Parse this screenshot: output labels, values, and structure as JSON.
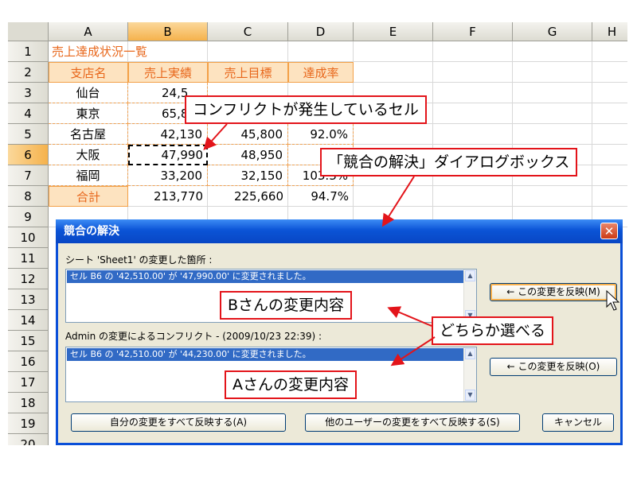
{
  "spreadsheet": {
    "columns": [
      "A",
      "B",
      "C",
      "D",
      "E",
      "F",
      "G",
      "H"
    ],
    "selected_column": "B",
    "rows": [
      "1",
      "2",
      "3",
      "4",
      "5",
      "6",
      "7",
      "8",
      "9",
      "10",
      "11",
      "12",
      "13",
      "14",
      "15",
      "16",
      "17",
      "18",
      "19",
      "20"
    ],
    "selected_row": "6",
    "title": "売上達成状況一覧",
    "headers": [
      "支店名",
      "売上実績",
      "売上目標",
      "達成率"
    ],
    "data": [
      {
        "branch": "仙台",
        "actual": "24,5",
        "target": "",
        "rate": ""
      },
      {
        "branch": "東京",
        "actual": "65,8",
        "target": "",
        "rate": ""
      },
      {
        "branch": "名古屋",
        "actual": "42,130",
        "target": "45,800",
        "rate": "92.0%"
      },
      {
        "branch": "大阪",
        "actual": "47,990",
        "target": "48,950",
        "rate": "9"
      },
      {
        "branch": "福岡",
        "actual": "33,200",
        "target": "32,150",
        "rate": "103.3%"
      }
    ],
    "total": {
      "label": "合計",
      "actual": "213,770",
      "target": "225,660",
      "rate": "94.7%"
    }
  },
  "callouts": {
    "conflict_cell": "コンフリクトが発生しているセル",
    "dialog_name": "「競合の解決」ダイアログボックス",
    "b_changes": "Bさんの変更内容",
    "choose": "どちらか選べる",
    "a_changes": "Aさんの変更内容"
  },
  "dialog": {
    "title": "競合の解決",
    "close_glyph": "✕",
    "my_changes_label": "シート 'Sheet1' の変更した箇所 :",
    "my_change_item": "セル B6 の '42,510.00' が '47,990.00' に変更されました。",
    "conflict_label": "Admin の変更によるコンフリクト - (2009/10/23 22:39) :",
    "conflict_item": "セル B6 の '42,510.00' が '44,230.00' に変更されました。",
    "accept_mine_button": "← この変更を反映(M)",
    "accept_other_button": "← この変更を反映(O)",
    "accept_all_mine_button": "自分の変更をすべて反映する(A)",
    "accept_all_others_button": "他のユーザーの変更をすべて反映する(S)",
    "cancel_button": "キャンセル",
    "scroll_up": "▲",
    "scroll_down": "▼"
  },
  "colors": {
    "accent": "#e8671b",
    "callout_border": "#e3141a",
    "titlebar": "#0b54d6",
    "selection": "#316ac5"
  }
}
